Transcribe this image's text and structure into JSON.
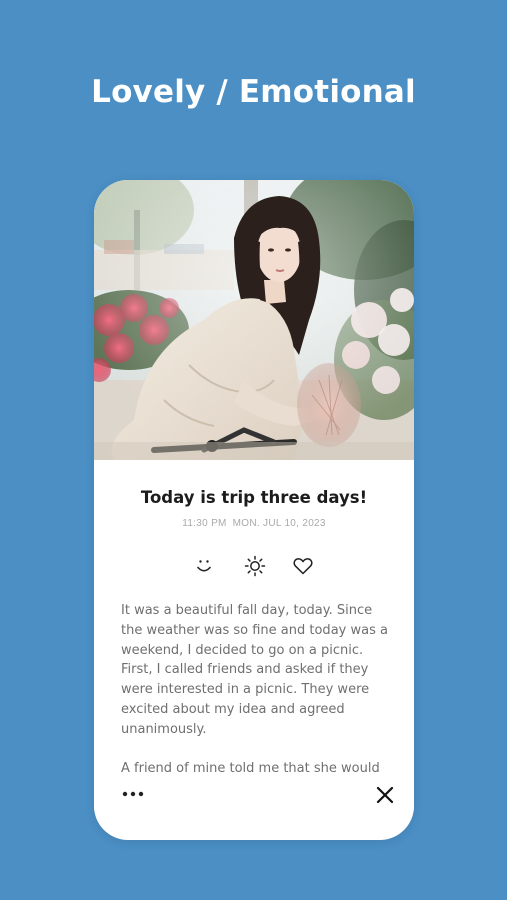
{
  "headline": "Lovely / Emotional",
  "entry": {
    "title": "Today is trip three days!",
    "time": "11:30 PM",
    "date": "MON. JUL 10, 2023",
    "paragraphs": [
      "It was a beautiful fall day, today. Since the weather was so fine and today was a weekend, I decided to go on a picnic. First, I called friends and asked if they were interested in a picnic. They were excited about my idea and agreed unanimously.",
      "A friend of mine told me that she would"
    ]
  },
  "icons": {
    "mood": "smile-icon",
    "weather": "sun-icon",
    "favorite": "heart-icon",
    "more": "more-dots-icon",
    "close": "close-icon"
  },
  "colors": {
    "background": "#4b8fc5",
    "card": "#ffffff",
    "title_text": "#1c1c1c",
    "body_text": "#6f6f6f",
    "date_text": "#a9a9a9"
  }
}
